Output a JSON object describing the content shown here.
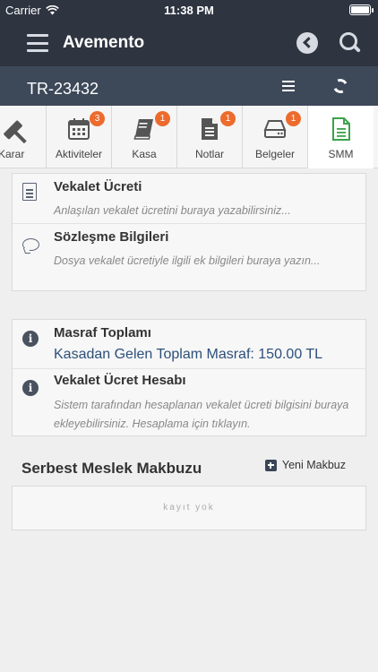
{
  "status_bar": {
    "carrier": "Carrier",
    "time": "11:38 PM"
  },
  "navbar": {
    "title": "Avemento"
  },
  "subbar": {
    "case_number": "TR-23432"
  },
  "tabs": [
    {
      "label": "Karar",
      "badge": ""
    },
    {
      "label": "Aktiviteler",
      "badge": "3"
    },
    {
      "label": "Kasa",
      "badge": "1"
    },
    {
      "label": "Notlar",
      "badge": "1"
    },
    {
      "label": "Belgeler",
      "badge": "1"
    },
    {
      "label": "SMM",
      "badge": ""
    }
  ],
  "fee_card": {
    "fee": {
      "title": "Vekalet Ücreti",
      "placeholder": "Anlaşılan vekalet ücretini buraya yazabilirsiniz..."
    },
    "contract": {
      "title": "Sözleşme Bilgileri",
      "placeholder": "Dosya vekalet ücretiyle ilgili ek bilgileri buraya yazın..."
    }
  },
  "expense_card": {
    "total": {
      "title": "Masraf Toplamı",
      "value": "Kasadan Gelen Toplam Masraf: 150.00 TL"
    },
    "calc": {
      "title": "Vekalet Ücret Hesabı",
      "description": "Sistem tarafından hesaplanan vekalet ücreti bilgisini buraya ekleyebilirsiniz. Hesaplama için tıklayın."
    }
  },
  "receipt_section": {
    "title": "Serbest Meslek Makbuzu",
    "new_button": "Yeni Makbuz",
    "empty_text": "kayıt yok"
  },
  "colors": {
    "nav_bg": "#2e3440",
    "subbar_bg": "#3d4859",
    "badge": "#ec6b2d",
    "active_tab_icon": "#3aa34a",
    "value_text": "#2d4f7a"
  }
}
